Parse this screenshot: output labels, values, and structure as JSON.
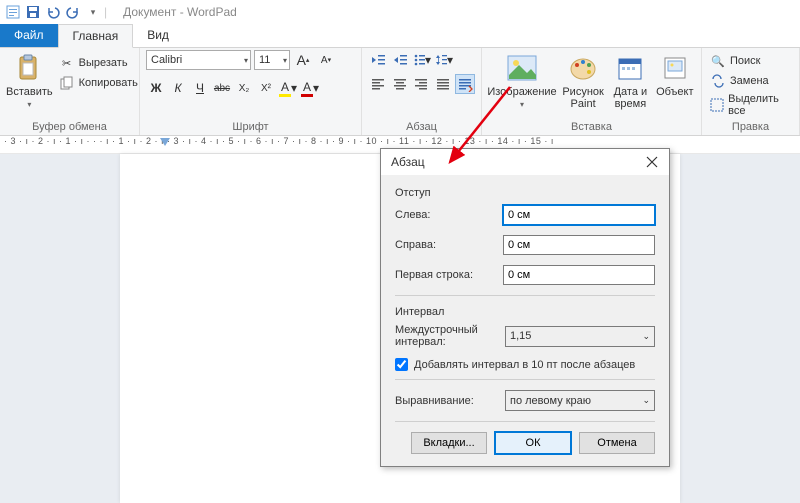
{
  "title": "Документ - WordPad",
  "qat": {
    "save": "save",
    "undo": "undo",
    "redo": "redo"
  },
  "tabs": {
    "file": "Файл",
    "home": "Главная",
    "view": "Вид"
  },
  "ribbon": {
    "clipboard": {
      "label": "Буфер обмена",
      "paste": "Вставить",
      "cut": "Вырезать",
      "copy": "Копировать"
    },
    "font": {
      "label": "Шрифт",
      "name": "Calibri",
      "size": "11",
      "grow": "A",
      "shrink": "A",
      "bold": "Ж",
      "italic": "К",
      "underline": "Ч",
      "strike": "abc",
      "sub": "X₂",
      "sup": "X²",
      "hicolor": "A",
      "color": "A"
    },
    "para": {
      "label": "Абзац"
    },
    "insert": {
      "label": "Вставка",
      "picture": "Изображение",
      "paint": "Рисунок Paint",
      "datetime": "Дата и время",
      "object": "Объект"
    },
    "editing": {
      "label": "Правка",
      "find": "Поиск",
      "replace": "Замена",
      "selectall": "Выделить все"
    }
  },
  "ruler_text": "· 3 · ı · 2 · ı · 1 · ı · · · ı · 1 · ı · 2 · ı · 3 · ı · 4 · ı · 5 · ı · 6 · ı · 7 · ı · 8 · ı · 9 · ı · 10 · ı · 11 · ı · 12 · ı · 13 · ı · 14 · ı · 15 · ı",
  "dialog": {
    "title": "Абзац",
    "section_indent": "Отступ",
    "left_label": "Слева:",
    "left_value": "0 см",
    "right_label": "Справа:",
    "right_value": "0 см",
    "first_label": "Первая строка:",
    "first_value": "0 см",
    "section_interval": "Интервал",
    "linespacing_label": "Междустрочный интервал:",
    "linespacing_value": "1,15",
    "add_space_checkbox": "Добавлять интервал в 10 пт после абзацев",
    "align_label": "Выравнивание:",
    "align_value": "по левому краю",
    "btn_tabs": "Вкладки...",
    "btn_ok": "ОК",
    "btn_cancel": "Отмена"
  }
}
